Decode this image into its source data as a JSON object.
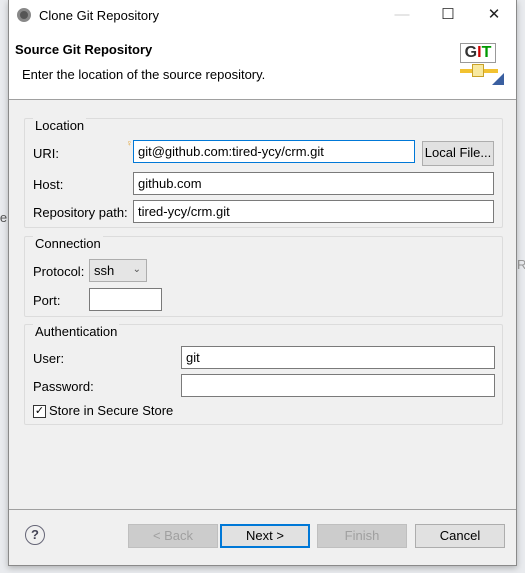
{
  "window": {
    "title": "Clone Git Repository"
  },
  "header": {
    "title": "Source Git Repository",
    "description": "Enter the location of the source repository.",
    "logo_text": "GIT"
  },
  "location": {
    "legend": "Location",
    "uri_label": "URI:",
    "uri_value": "git@github.com:tired-ycy/crm.git",
    "local_file_label": "Local File...",
    "host_label": "Host:",
    "host_value": "github.com",
    "path_label": "Repository path:",
    "path_value": "tired-ycy/crm.git"
  },
  "connection": {
    "legend": "Connection",
    "protocol_label": "Protocol:",
    "protocol_value": "ssh",
    "port_label": "Port:",
    "port_value": ""
  },
  "auth": {
    "legend": "Authentication",
    "user_label": "User:",
    "user_value": "git",
    "password_label": "Password:",
    "password_value": "",
    "store_label": "Store in Secure Store",
    "store_checked": true
  },
  "footer": {
    "back": "< Back",
    "next": "Next >",
    "finish": "Finish",
    "cancel": "Cancel"
  },
  "background": {
    "left_text": "ie",
    "right_text": "R"
  }
}
